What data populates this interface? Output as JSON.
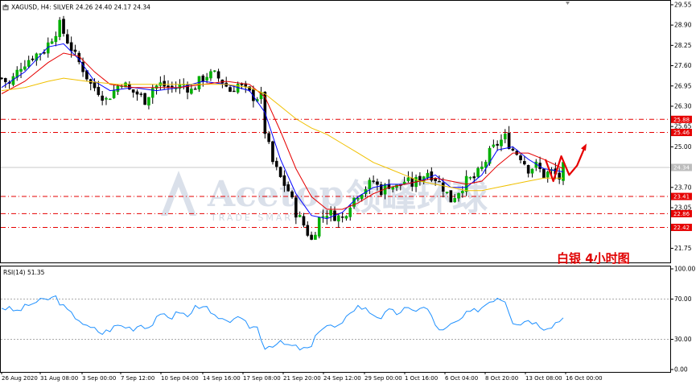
{
  "header": {
    "symbol_line": "XAGUSD, H4:  SILVER  24.26 24.40 24.17 24.34",
    "rsi_label": "RSI(14) 51.35"
  },
  "caption": "白银  4小时图",
  "watermark": {
    "text_en": "Acetop",
    "text_cn": "领峰环球",
    "sub": "TRADE SMART"
  },
  "price_axis": {
    "ticks": [
      "29.55",
      "28.90",
      "28.25",
      "27.60",
      "26.95",
      "26.30",
      "25.65",
      "25.00",
      "24.35",
      "23.70",
      "23.05",
      "22.40",
      "21.75"
    ],
    "tags": [
      {
        "label": "25.88",
        "price": 25.88,
        "color": "#e60000"
      },
      {
        "label": "25.46",
        "price": 25.46,
        "color": "#e60000"
      },
      {
        "label": "24.34",
        "price": 24.34,
        "color": "#bcbcbc"
      },
      {
        "label": "23.41",
        "price": 23.41,
        "color": "#e60000"
      },
      {
        "label": "22.86",
        "price": 22.86,
        "color": "#e60000"
      },
      {
        "label": "22.42",
        "price": 22.42,
        "color": "#e60000"
      }
    ]
  },
  "rsi_axis": {
    "ticks": [
      "100.00",
      "70.00",
      "30.00",
      "0.00"
    ]
  },
  "date_axis": {
    "labels": [
      "26 Aug 2020",
      "31 Aug 08:00",
      "3 Sep 00:00",
      "7 Sep 12:00",
      "10 Sep 04:00",
      "14 Sep 16:00",
      "17 Sep 08:00",
      "21 Sep 20:00",
      "24 Sep 12:00",
      "29 Sep 00:00",
      "1 Oct 16:00",
      "6 Oct 04:00",
      "8 Oct 20:00",
      "13 Oct 08:00",
      "16 Oct 00:00"
    ]
  },
  "chart_data": {
    "type": "candlestick",
    "symbol": "XAGUSD",
    "timeframe": "H4",
    "ylim": [
      21.4,
      29.6
    ],
    "rsi_ylim": [
      0,
      100
    ],
    "horizontal_levels": [
      25.88,
      25.46,
      23.41,
      22.86,
      22.42
    ],
    "current_price_line": 24.34,
    "close_path": [
      [
        0,
        27.2
      ],
      [
        2,
        27.0
      ],
      [
        5,
        27.6
      ],
      [
        8,
        27.9
      ],
      [
        11,
        28.1
      ],
      [
        13,
        28.5
      ],
      [
        15,
        28.9
      ],
      [
        17,
        28.4
      ],
      [
        19,
        27.9
      ],
      [
        21,
        27.5
      ],
      [
        23,
        27.0
      ],
      [
        25,
        26.8
      ],
      [
        27,
        26.5
      ],
      [
        29,
        26.8
      ],
      [
        31,
        27.1
      ],
      [
        33,
        26.8
      ],
      [
        35,
        26.7
      ],
      [
        37,
        26.5
      ],
      [
        39,
        26.9
      ],
      [
        41,
        27.0
      ],
      [
        43,
        26.9
      ],
      [
        45,
        26.9
      ],
      [
        47,
        27.0
      ],
      [
        49,
        26.8
      ],
      [
        51,
        27.1
      ],
      [
        53,
        27.3
      ],
      [
        55,
        27.3
      ],
      [
        57,
        27.1
      ],
      [
        59,
        26.8
      ],
      [
        61,
        27.0
      ],
      [
        63,
        26.8
      ],
      [
        65,
        26.6
      ],
      [
        67,
        26.6
      ],
      [
        68,
        25.5
      ],
      [
        70,
        24.5
      ],
      [
        72,
        24.0
      ],
      [
        74,
        23.6
      ],
      [
        76,
        22.9
      ],
      [
        78,
        22.5
      ],
      [
        80,
        22.0
      ],
      [
        82,
        22.7
      ],
      [
        84,
        22.9
      ],
      [
        86,
        22.8
      ],
      [
        88,
        22.7
      ],
      [
        90,
        23.2
      ],
      [
        92,
        23.5
      ],
      [
        94,
        23.7
      ],
      [
        96,
        23.9
      ],
      [
        98,
        23.6
      ],
      [
        100,
        23.8
      ],
      [
        102,
        23.7
      ],
      [
        104,
        23.9
      ],
      [
        106,
        23.8
      ],
      [
        108,
        24.0
      ],
      [
        110,
        24.2
      ],
      [
        112,
        24.0
      ],
      [
        114,
        23.7
      ],
      [
        116,
        23.3
      ],
      [
        118,
        23.6
      ],
      [
        120,
        23.9
      ],
      [
        122,
        24.0
      ],
      [
        124,
        24.3
      ],
      [
        126,
        24.8
      ],
      [
        128,
        25.1
      ],
      [
        130,
        25.3
      ],
      [
        132,
        24.9
      ],
      [
        134,
        24.7
      ],
      [
        136,
        24.3
      ],
      [
        138,
        24.4
      ],
      [
        140,
        24.1
      ],
      [
        142,
        24.2
      ],
      [
        144,
        24.0
      ],
      [
        145,
        24.34
      ]
    ],
    "moving_averages": [
      {
        "color": "#0000ff",
        "values": [
          [
            0,
            26.9
          ],
          [
            6,
            27.4
          ],
          [
            12,
            28.2
          ],
          [
            16,
            28.3
          ],
          [
            20,
            27.8
          ],
          [
            24,
            27.1
          ],
          [
            28,
            26.8
          ],
          [
            34,
            26.9
          ],
          [
            40,
            26.8
          ],
          [
            46,
            26.9
          ],
          [
            52,
            27.1
          ],
          [
            58,
            27.0
          ],
          [
            64,
            26.8
          ],
          [
            68,
            26.1
          ],
          [
            72,
            24.6
          ],
          [
            76,
            23.5
          ],
          [
            80,
            22.8
          ],
          [
            84,
            22.7
          ],
          [
            88,
            22.9
          ],
          [
            92,
            23.4
          ],
          [
            96,
            23.7
          ],
          [
            100,
            23.8
          ],
          [
            104,
            23.8
          ],
          [
            108,
            23.9
          ],
          [
            112,
            24.1
          ],
          [
            116,
            23.7
          ],
          [
            120,
            23.7
          ],
          [
            124,
            24.1
          ],
          [
            128,
            24.9
          ],
          [
            132,
            25.0
          ],
          [
            136,
            24.6
          ],
          [
            140,
            24.3
          ],
          [
            145,
            24.2
          ]
        ]
      },
      {
        "color": "#e60000",
        "values": [
          [
            0,
            26.7
          ],
          [
            6,
            27.1
          ],
          [
            12,
            27.7
          ],
          [
            16,
            28.0
          ],
          [
            20,
            27.9
          ],
          [
            24,
            27.4
          ],
          [
            28,
            27.0
          ],
          [
            34,
            26.9
          ],
          [
            40,
            26.9
          ],
          [
            46,
            26.9
          ],
          [
            52,
            27.0
          ],
          [
            58,
            27.1
          ],
          [
            64,
            27.0
          ],
          [
            68,
            26.6
          ],
          [
            72,
            25.5
          ],
          [
            76,
            24.3
          ],
          [
            80,
            23.4
          ],
          [
            84,
            23.0
          ],
          [
            88,
            23.0
          ],
          [
            92,
            23.2
          ],
          [
            96,
            23.5
          ],
          [
            100,
            23.7
          ],
          [
            104,
            23.8
          ],
          [
            108,
            23.9
          ],
          [
            112,
            24.0
          ],
          [
            116,
            23.9
          ],
          [
            120,
            23.8
          ],
          [
            124,
            23.9
          ],
          [
            128,
            24.4
          ],
          [
            132,
            24.8
          ],
          [
            136,
            24.8
          ],
          [
            140,
            24.6
          ],
          [
            145,
            24.3
          ]
        ]
      },
      {
        "color": "#f0c000",
        "values": [
          [
            0,
            26.8
          ],
          [
            6,
            26.9
          ],
          [
            12,
            27.1
          ],
          [
            16,
            27.2
          ],
          [
            22,
            27.1
          ],
          [
            30,
            27.0
          ],
          [
            40,
            27.0
          ],
          [
            50,
            27.0
          ],
          [
            58,
            27.0
          ],
          [
            64,
            26.9
          ],
          [
            68,
            26.7
          ],
          [
            72,
            26.3
          ],
          [
            76,
            25.9
          ],
          [
            80,
            25.6
          ],
          [
            84,
            25.4
          ],
          [
            88,
            25.1
          ],
          [
            92,
            24.8
          ],
          [
            96,
            24.5
          ],
          [
            100,
            24.3
          ],
          [
            104,
            24.1
          ],
          [
            108,
            23.9
          ],
          [
            112,
            23.8
          ],
          [
            116,
            23.7
          ],
          [
            120,
            23.6
          ],
          [
            124,
            23.6
          ],
          [
            128,
            23.7
          ],
          [
            132,
            23.8
          ],
          [
            136,
            23.9
          ],
          [
            140,
            24.0
          ],
          [
            145,
            24.0
          ]
        ]
      }
    ],
    "rsi": [
      [
        0,
        62
      ],
      [
        4,
        58
      ],
      [
        8,
        66
      ],
      [
        12,
        70
      ],
      [
        14,
        72
      ],
      [
        16,
        62
      ],
      [
        18,
        55
      ],
      [
        20,
        50
      ],
      [
        22,
        42
      ],
      [
        24,
        40
      ],
      [
        26,
        36
      ],
      [
        28,
        40
      ],
      [
        30,
        44
      ],
      [
        34,
        41
      ],
      [
        36,
        45
      ],
      [
        38,
        42
      ],
      [
        40,
        50
      ],
      [
        42,
        55
      ],
      [
        44,
        52
      ],
      [
        46,
        58
      ],
      [
        48,
        52
      ],
      [
        50,
        62
      ],
      [
        52,
        65
      ],
      [
        54,
        55
      ],
      [
        56,
        50
      ],
      [
        58,
        46
      ],
      [
        60,
        52
      ],
      [
        62,
        48
      ],
      [
        64,
        43
      ],
      [
        66,
        42
      ],
      [
        68,
        22
      ],
      [
        70,
        25
      ],
      [
        72,
        26
      ],
      [
        74,
        24
      ],
      [
        76,
        22
      ],
      [
        78,
        20
      ],
      [
        80,
        22
      ],
      [
        82,
        40
      ],
      [
        84,
        44
      ],
      [
        86,
        42
      ],
      [
        88,
        44
      ],
      [
        90,
        58
      ],
      [
        92,
        63
      ],
      [
        94,
        60
      ],
      [
        96,
        55
      ],
      [
        98,
        52
      ],
      [
        100,
        58
      ],
      [
        102,
        56
      ],
      [
        104,
        60
      ],
      [
        106,
        58
      ],
      [
        108,
        62
      ],
      [
        110,
        60
      ],
      [
        112,
        44
      ],
      [
        114,
        38
      ],
      [
        116,
        44
      ],
      [
        118,
        48
      ],
      [
        120,
        55
      ],
      [
        122,
        58
      ],
      [
        124,
        62
      ],
      [
        126,
        68
      ],
      [
        128,
        72
      ],
      [
        130,
        69
      ],
      [
        132,
        48
      ],
      [
        134,
        46
      ],
      [
        136,
        50
      ],
      [
        138,
        46
      ],
      [
        140,
        42
      ],
      [
        142,
        44
      ],
      [
        145,
        51.35
      ]
    ],
    "forecast_arrow": [
      [
        140,
        24.6
      ],
      [
        141,
        23.9
      ],
      [
        142,
        24.7
      ],
      [
        143,
        24.1
      ],
      [
        144,
        24.4
      ],
      [
        145,
        25.0
      ]
    ]
  }
}
